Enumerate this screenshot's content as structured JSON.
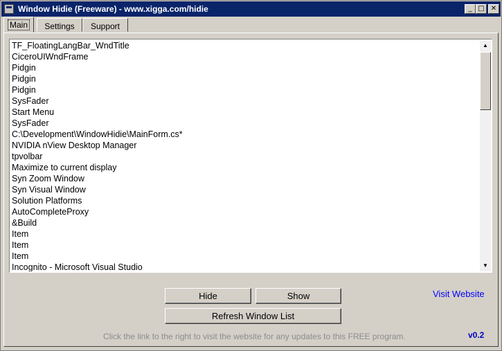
{
  "window": {
    "title": "Window Hidie (Freeware) - www.xigga.com/hidie",
    "controls": {
      "minimize": "_",
      "maximize": "□",
      "close": "✕"
    }
  },
  "tabs": [
    {
      "label": "Main",
      "active": true
    },
    {
      "label": "Settings",
      "active": false
    },
    {
      "label": "Support",
      "active": false
    }
  ],
  "window_list": [
    "TF_FloatingLangBar_WndTitle",
    "CiceroUIWndFrame",
    "Pidgin",
    "Pidgin",
    "Pidgin",
    "SysFader",
    "Start Menu",
    "SysFader",
    "C:\\Development\\WindowHidie\\MainForm.cs*",
    "NVIDIA nView Desktop Manager",
    "tpvolbar",
    "Maximize to current display",
    "Syn Zoom Window",
    "Syn Visual Window",
    "Solution Platforms",
    "AutoCompleteProxy",
    "&Build",
    "Item",
    "Item",
    "Item",
    "Incognito - Microsoft Visual Studio"
  ],
  "scrollbar": {
    "up_icon": "triangle-up",
    "down_icon": "triangle-down",
    "up_glyph": "▲",
    "down_glyph": "▼"
  },
  "buttons": {
    "hide": "Hide",
    "show": "Show",
    "refresh": "Refresh Window List"
  },
  "visit_link": "Visit Website",
  "hint": "Click the link to the right to visit the website for any updates to this FREE program.",
  "version": "v0.2",
  "colors": {
    "titlebar": "#0a246a",
    "face": "#d4d0c8",
    "link": "#0000ff",
    "version": "#0000c0",
    "hint": "#8c8c8c"
  }
}
